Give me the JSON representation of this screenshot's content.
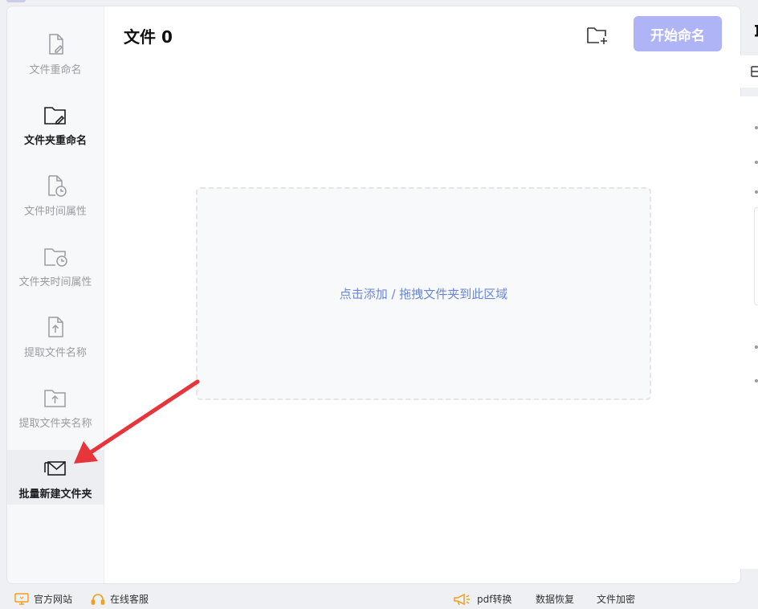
{
  "sidebar": {
    "items": [
      {
        "label": "文件重命名",
        "icon": "file-edit-icon"
      },
      {
        "label": "文件夹重命名",
        "icon": "folder-edit-icon"
      },
      {
        "label": "文件时间属性",
        "icon": "file-clock-icon"
      },
      {
        "label": "文件夹时间属性",
        "icon": "folder-clock-icon"
      },
      {
        "label": "提取文件名称",
        "icon": "file-upload-icon"
      },
      {
        "label": "提取文件夹名称",
        "icon": "folder-upload-icon"
      },
      {
        "label": "批量新建文件夹",
        "icon": "stacked-mail-icon"
      }
    ]
  },
  "header": {
    "file_count_title": "文件 0",
    "add_folder_icon": "folder-plus-icon",
    "start_button": "开始命名"
  },
  "dropzone": {
    "hint": "点击添加 / 拖拽文件夹到此区域"
  },
  "footer": {
    "left": [
      {
        "label": "官方网站",
        "icon": "monitor-icon"
      },
      {
        "label": "在线客服",
        "icon": "headset-icon"
      }
    ],
    "right": [
      {
        "label": "pdf转换",
        "icon": "megaphone-icon"
      },
      {
        "label": "数据恢复"
      },
      {
        "label": "文件加密"
      }
    ]
  },
  "colors": {
    "accent_button": "#aeb4f6",
    "hint_text": "#6a86d8",
    "arrow": "#e8353b"
  }
}
